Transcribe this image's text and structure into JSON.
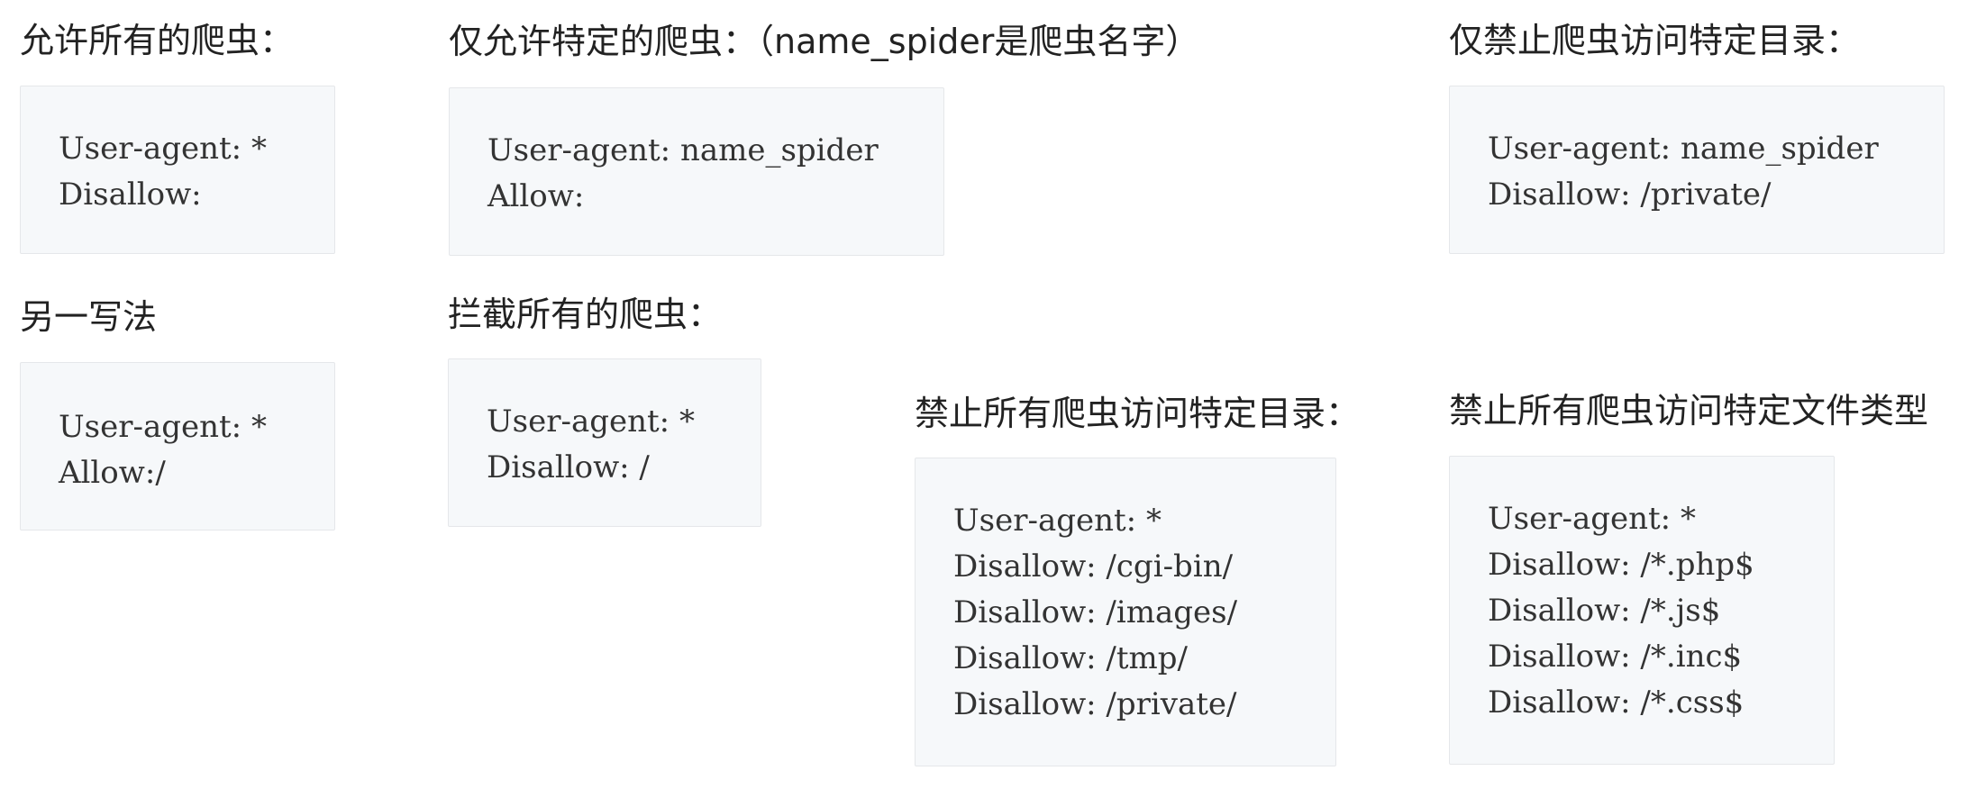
{
  "sections": [
    {
      "title": "允许所有的爬虫：",
      "lines": [
        "User-agent: *",
        "Disallow:"
      ]
    },
    {
      "title": "仅允许特定的爬虫：（name_spider是爬虫名字）",
      "lines": [
        "User-agent: name_spider",
        "Allow:"
      ]
    },
    {
      "title": "仅禁止爬虫访问特定目录：",
      "lines": [
        "User-agent: name_spider",
        "Disallow: /private/"
      ]
    },
    {
      "title": "另一写法",
      "lines": [
        "User-agent: *",
        "Allow:/"
      ]
    },
    {
      "title": "拦截所有的爬虫：",
      "lines": [
        "User-agent: *",
        "Disallow: /"
      ]
    },
    {
      "title": "禁止所有爬虫访问特定目录：",
      "lines": [
        "User-agent: *",
        "Disallow: /cgi-bin/",
        "Disallow: /images/",
        "Disallow: /tmp/",
        "Disallow: /private/"
      ]
    },
    {
      "title": "禁止所有爬虫访问特定文件类型",
      "lines": [
        "User-agent: *",
        "Disallow: /*.php$",
        "Disallow: /*.js$",
        "Disallow: /*.inc$",
        "Disallow: /*.css$"
      ]
    }
  ]
}
